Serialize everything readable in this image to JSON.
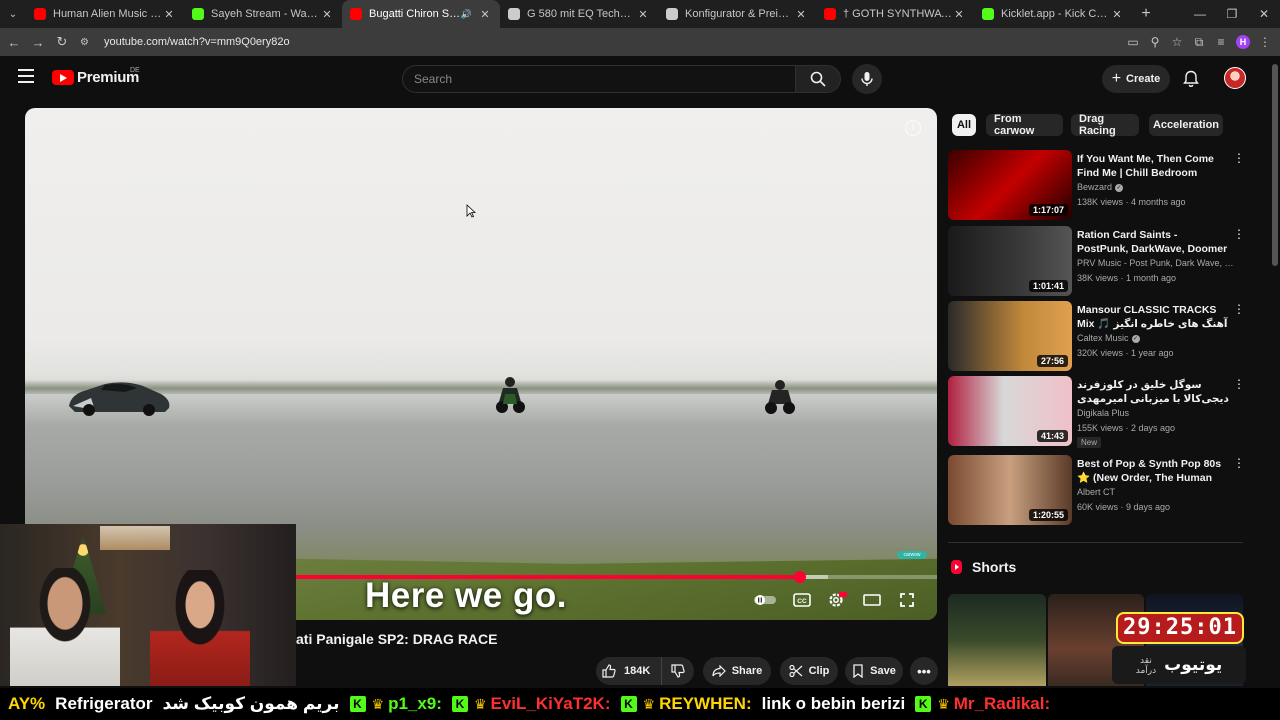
{
  "browser": {
    "tabs": [
      {
        "title": "Human Alien Music From Plane",
        "color": "#ff0000",
        "active": false
      },
      {
        "title": "Sayeh Stream - Watch Live on K",
        "color": "#53fc18",
        "active": false
      },
      {
        "title": "Bugatti Chiron SS v Kawasa",
        "color": "#ff0000",
        "active": true
      },
      {
        "title": "G 580 mit EQ Technologie - Ra",
        "color": "#cccccc",
        "active": false
      },
      {
        "title": "Konfigurator & Preise | Merced",
        "color": "#cccccc",
        "active": false
      },
      {
        "title": "† GOTH SYNTHWAVE MIX | BE",
        "color": "#ff0000",
        "active": false
      },
      {
        "title": "Kicklet.app - Kick Chatbot and",
        "color": "#53fc18",
        "active": false
      }
    ],
    "url": "youtube.com/watch?v=mm9Q0ery82o",
    "profile_letter": "H"
  },
  "masthead": {
    "logo_text": "Premium",
    "country_code": "DE",
    "search_placeholder": "Search",
    "create_label": "Create"
  },
  "player": {
    "caption": "Here we go.",
    "progress_played": 0.85,
    "progress_buffered": 0.88,
    "watermark": "carwow"
  },
  "video": {
    "title_visible": "ati Panigale SP2: DRAG RACE",
    "likes": "184K",
    "share_label": "Share",
    "clip_label": "Clip",
    "save_label": "Save"
  },
  "chips": [
    "All",
    "From carwow",
    "Drag Racing",
    "Acceleration"
  ],
  "recommendations": [
    {
      "title": "If You Want Me, Then Come Find Me | Chill Bedroom Playli...",
      "channel": "Bewzard",
      "verified": true,
      "meta": "138K views · 4 months ago",
      "duration": "1:17:07",
      "thumb": "linear-gradient(135deg,#3a0000,#c40000 50%,#200000)"
    },
    {
      "title": "Ration Card Saints - PostPunk, DarkWave, Doomer Music ...",
      "channel": "PRV Music - Post Punk, Dark Wave, Doo...",
      "verified": false,
      "meta": "38K views · 1 month ago",
      "duration": "1:01:41",
      "thumb": "linear-gradient(90deg,#1a1a1a,#3a3a3a 60%,#555)"
    },
    {
      "title": "Mansour CLASSIC TRACKS Mix 🎵 آهنگ های خاطره انگیز منصور از ...",
      "channel": "Caltex Music",
      "verified": true,
      "meta": "320K views · 1 year ago",
      "duration": "27:56",
      "thumb": "linear-gradient(90deg,#2a2a2a,#c0883a 60%,#e0a050)"
    },
    {
      "title": "سوگل خلیق در کلوزفرند دیجی‌کالا با میزبانی امیرمهدی ژوله",
      "channel": "Digikala Plus",
      "verified": false,
      "meta": "155K views · 2 days ago",
      "duration": "41:43",
      "thumb": "linear-gradient(90deg,#b02040,#d8d8d8 45%,#f0c0c8)",
      "badge": "New"
    },
    {
      "title": "Best of Pop & Synth Pop 80s ⭐ (New Order, The Human League...",
      "channel": "Albert CT",
      "verified": false,
      "meta": "60K views · 9 days ago",
      "duration": "1:20:55",
      "thumb": "linear-gradient(90deg,#7a4a30,#c8a080 50%,#5a3a28)"
    }
  ],
  "shorts_label": "Shorts",
  "overlay": {
    "timer": "29:25:01",
    "shorts_main": "یوتیوب",
    "shorts_sub_1": "نقد",
    "shorts_sub_2": "درآمد"
  },
  "ticker": [
    {
      "text": "AY%",
      "cls": "y",
      "k": false
    },
    {
      "text": "Refrigerator",
      "cls": "w",
      "k": false
    },
    {
      "text": "بریم همون کوبیک شد",
      "cls": "w",
      "k": false
    },
    {
      "text": "p1_x9:",
      "cls": "g",
      "k": true
    },
    {
      "text": "EviL_KiYaT2K:",
      "cls": "r",
      "k": true
    },
    {
      "text": "REYWHEN:",
      "cls": "y",
      "k": true
    },
    {
      "text": "link o bebin berizi",
      "cls": "w",
      "k": false
    },
    {
      "text": "Mr_Radikal:",
      "cls": "r",
      "k": true
    }
  ]
}
